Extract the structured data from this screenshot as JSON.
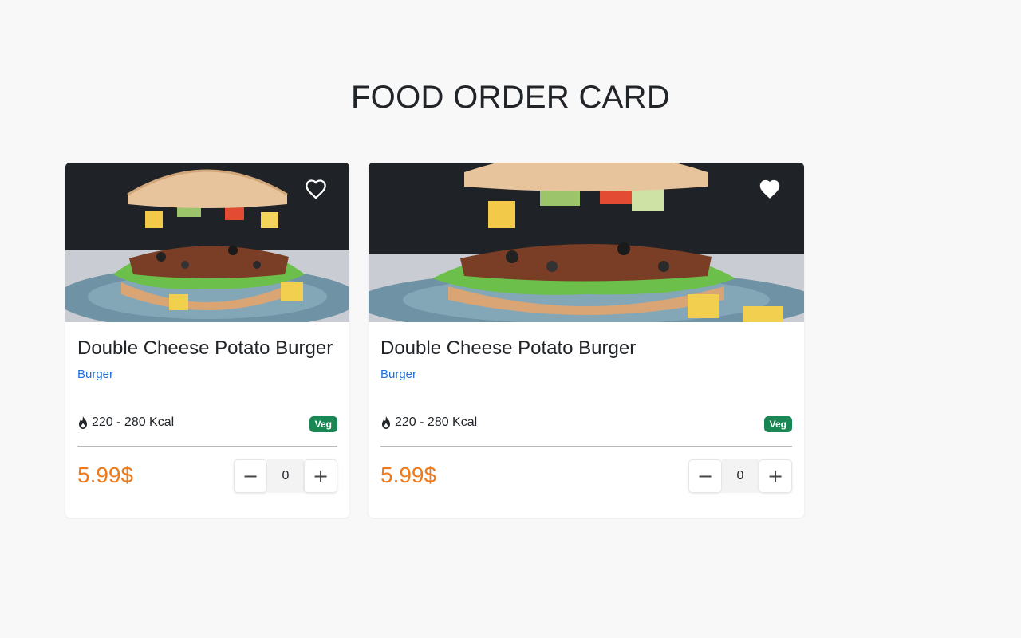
{
  "page": {
    "title": "FOOD ORDER CARD"
  },
  "cards": [
    {
      "title": "Double Cheese Potato Burger",
      "category": "Burger",
      "calories": "220 - 280 Kcal",
      "badge": "Veg",
      "price": "5.99$",
      "quantity": "0",
      "favorited": false
    },
    {
      "title": "Double Cheese Potato Burger",
      "category": "Burger",
      "calories": "220 - 280 Kcal",
      "badge": "Veg",
      "price": "5.99$",
      "quantity": "0",
      "favorited": true
    }
  ],
  "stepper": {
    "minus": "−",
    "plus": "+"
  },
  "colors": {
    "accent_price": "#f07a1a",
    "link": "#1e6fd9",
    "badge": "#198754",
    "background": "#f8f8f8"
  }
}
